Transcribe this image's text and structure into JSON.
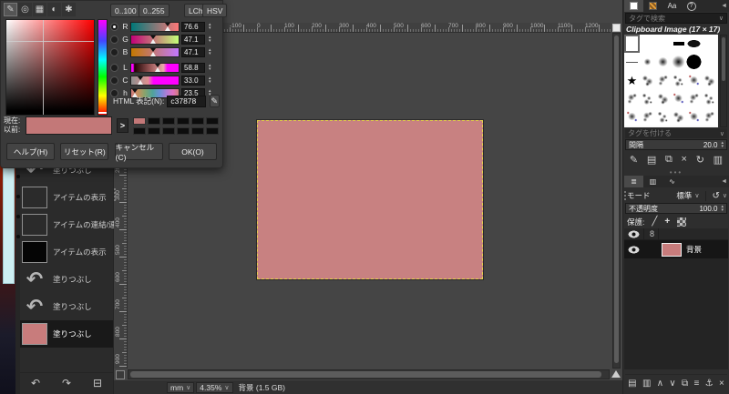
{
  "colors": {
    "accent_pink": "#c37878",
    "canvas_fill": "#c88181",
    "selection_dash": "#e3cf4b"
  },
  "color_dialog": {
    "selector_tabs": [
      {
        "name": "gimp-selector-tab",
        "glyph": "✎",
        "active": true
      },
      {
        "name": "watercolor-selector-tab",
        "glyph": "◎",
        "active": false
      },
      {
        "name": "cmyk-selector-tab",
        "glyph": "▦",
        "active": false
      },
      {
        "name": "wheel-selector-tab",
        "glyph": "◐",
        "active": false
      },
      {
        "name": "palette-selector-tab",
        "glyph": "✱",
        "active": false
      }
    ],
    "range_buttons": [
      {
        "label": "0..100"
      },
      {
        "label": "0..255"
      }
    ],
    "model_buttons": [
      {
        "label": "LCh"
      },
      {
        "label": "HSV"
      }
    ],
    "sliders": [
      {
        "label": "R",
        "value": "76.6",
        "pos": 76,
        "active": true,
        "grad_class": "grad-r"
      },
      {
        "label": "G",
        "value": "47.1",
        "pos": 47,
        "active": false,
        "grad_class": "grad-g"
      },
      {
        "label": "B",
        "value": "47.1",
        "pos": 47,
        "active": false,
        "grad_class": "grad-b"
      },
      {
        "label": "L",
        "value": "58.8",
        "pos": 55,
        "active": false,
        "grad_class": "grad-l"
      },
      {
        "label": "C",
        "value": "33.0",
        "pos": 19,
        "active": false,
        "grad_class": "grad-c"
      },
      {
        "label": "h",
        "value": "23.5",
        "pos": 7,
        "active": false,
        "grad_class": "grad-h"
      }
    ],
    "html_label": "HTML 表記(N):",
    "html_value": "c37878",
    "current_label": "現在:",
    "previous_label": "以前:",
    "palette_swatches": [
      "#c37878",
      "",
      "",
      "",
      "",
      "",
      "",
      "",
      "",
      "",
      "",
      ""
    ],
    "expand_glyph": ">",
    "buttons": [
      {
        "label": "ヘルプ(H)",
        "name": "help-button"
      },
      {
        "label": "リセット(R)",
        "name": "reset-button"
      },
      {
        "label": "キャンセル(C)",
        "name": "cancel-button"
      },
      {
        "label": "OK(O)",
        "name": "ok-button"
      }
    ]
  },
  "history_panel": {
    "items": [
      {
        "label": "塗りつぶし",
        "thumb": "arrow",
        "selected": false
      },
      {
        "label": "アイテムの表示",
        "thumb": "empty",
        "selected": false
      },
      {
        "label": "アイテムの連結/連結解除",
        "thumb": "empty",
        "selected": false
      },
      {
        "label": "アイテムの表示",
        "thumb": "black",
        "selected": false
      },
      {
        "label": "塗りつぶし",
        "thumb": "arrow",
        "selected": false
      },
      {
        "label": "塗りつぶし",
        "thumb": "arrow",
        "selected": false
      },
      {
        "label": "塗りつぶし",
        "thumb": "pink",
        "selected": true
      }
    ],
    "arrow_glyph": "↶",
    "toolbar": [
      {
        "name": "undo-button",
        "glyph": "↶"
      },
      {
        "name": "redo-button",
        "glyph": "↷"
      },
      {
        "name": "clear-history-button",
        "glyph": "⊟"
      }
    ]
  },
  "canvas": {
    "h_ruler": {
      "start": -100,
      "step": 100,
      "count": 14
    },
    "v_ruler": {
      "start": 100,
      "step": 100,
      "count": 9
    }
  },
  "status_bar": {
    "unit": "mm",
    "zoom": "4.35%",
    "info": "背景 (1.5 GB)"
  },
  "brushes_panel": {
    "tabs": [
      {
        "name": "brushes-tab",
        "icon": "brush-swatch",
        "active": true
      },
      {
        "name": "patterns-tab",
        "icon": "pattern-swatch",
        "active": false
      },
      {
        "name": "fonts-tab",
        "label": "Aa",
        "active": false
      },
      {
        "name": "document-history-tab",
        "label": "?",
        "active": false
      }
    ],
    "search_placeholder": "タグで検索",
    "title": "Clipboard Image (17 × 17)",
    "grid": [
      [
        "sel",
        "blank",
        "blank",
        "bar",
        "pill",
        "blank"
      ],
      [
        "line",
        "soft1",
        "soft2",
        "soft3",
        "disc",
        "blank"
      ],
      [
        "star",
        "tex1",
        "tex2",
        "tex3",
        "tex4",
        "tex1"
      ],
      [
        "tex2",
        "tex3",
        "tex1",
        "tex4",
        "tex2",
        "tex3"
      ],
      [
        "tex4",
        "tex2",
        "tex3",
        "tex1",
        "tex4",
        "tex2"
      ]
    ],
    "star_glyph": "★",
    "tag_placeholder": "タグを付ける",
    "spacing_label": "間隔",
    "spacing_value": "20.0",
    "toolbar": [
      {
        "name": "edit-brush-button",
        "glyph": "✎"
      },
      {
        "name": "new-brush-button",
        "glyph": "▤"
      },
      {
        "name": "duplicate-brush-button",
        "glyph": "⧉"
      },
      {
        "name": "delete-brush-button",
        "glyph": "×"
      },
      {
        "name": "refresh-brushes-button",
        "glyph": "↻"
      },
      {
        "name": "open-brush-as-image-button",
        "glyph": "▥"
      }
    ]
  },
  "layers_panel": {
    "tabs": [
      {
        "name": "layers-tab",
        "glyph": "≣",
        "active": true
      },
      {
        "name": "channels-tab",
        "glyph": "▥",
        "active": false
      },
      {
        "name": "paths-tab",
        "glyph": "∿",
        "active": false
      }
    ],
    "mode_label": "モード",
    "mode_value": "標準",
    "opacity_label": "不透明度",
    "opacity_value": "100.0",
    "lock_label": "保護:",
    "layers": [
      {
        "name": "背景",
        "visible": true,
        "selected": true
      }
    ],
    "toolbar": [
      {
        "name": "new-layer-button",
        "glyph": "▤"
      },
      {
        "name": "new-group-button",
        "glyph": "▥"
      },
      {
        "name": "raise-layer-button",
        "glyph": "∧"
      },
      {
        "name": "lower-layer-button",
        "glyph": "∨"
      },
      {
        "name": "duplicate-layer-button",
        "glyph": "⧉"
      },
      {
        "name": "merge-layer-button",
        "glyph": "≡"
      },
      {
        "name": "anchor-layer-button",
        "glyph": "⚓"
      },
      {
        "name": "delete-layer-button",
        "glyph": "×"
      }
    ]
  }
}
